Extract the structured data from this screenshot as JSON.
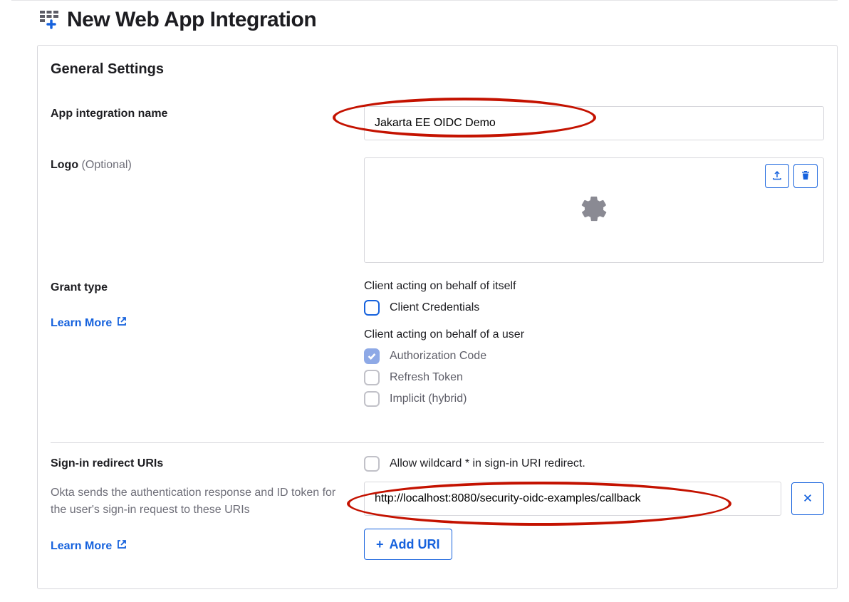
{
  "header": {
    "title": "New Web App Integration"
  },
  "general": {
    "section_title": "General Settings",
    "app_name_label": "App integration name",
    "app_name_value": "Jakarta EE OIDC Demo",
    "logo_label": "Logo",
    "logo_optional": "(Optional)"
  },
  "grant": {
    "label": "Grant type",
    "learn_more": "Learn More",
    "self_heading": "Client acting on behalf of itself",
    "client_credentials_label": "Client Credentials",
    "user_heading": "Client acting on behalf of a user",
    "auth_code_label": "Authorization Code",
    "refresh_label": "Refresh Token",
    "implicit_label": "Implicit (hybrid)"
  },
  "redirect": {
    "label": "Sign-in redirect URIs",
    "wildcard_label": "Allow wildcard * in sign-in URI redirect.",
    "help_text": "Okta sends the authentication response and ID token for the user's sign-in request to these URIs",
    "learn_more": "Learn More",
    "uri_value": "http://localhost:8080/security-oidc-examples/callback",
    "add_uri": "Add URI"
  }
}
